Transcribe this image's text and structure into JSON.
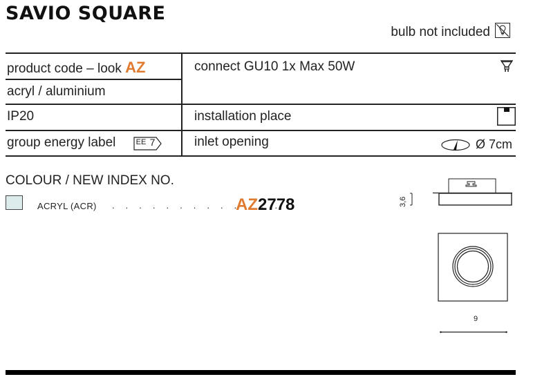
{
  "header": {
    "title": "SAVIO SQUARE",
    "bulb_note": "bulb not included",
    "bulb_icon": "bulb-not-included-icon"
  },
  "specs": {
    "left": [
      {
        "label": "product code – look",
        "highlight": "AZ"
      },
      {
        "label": "acryl / aluminium"
      },
      {
        "label": "IP20"
      },
      {
        "label": "group energy label",
        "badge_prefix": "EE",
        "badge_value": "7"
      }
    ],
    "right": [
      {
        "label": "connect GU10 1x Max 50W",
        "icon": "gu10-bulb-icon"
      },
      {
        "label": "installation place",
        "icon": "ceiling-installation-icon"
      },
      {
        "label": "inlet opening",
        "icon": "inlet-opening-icon",
        "value": "Ø 7cm"
      }
    ]
  },
  "colours": {
    "heading": "COLOUR / NEW INDEX NO.",
    "items": [
      {
        "name": "ACRYL (ACR)",
        "dots": ". . . . . . . . . . . . .",
        "code_prefix": "AZ",
        "code_number": "2778",
        "swatch": "#dcecec"
      }
    ]
  },
  "drawings": {
    "side_height": "3,6",
    "top_width": "9"
  },
  "colors": {
    "accent": "#e07a2e",
    "text": "#222222",
    "rule": "#000000"
  }
}
